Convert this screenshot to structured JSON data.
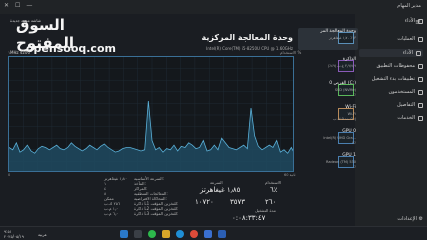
{
  "window": {
    "title": "مدير المهام",
    "controls": [
      "—",
      "☐",
      "✕"
    ]
  },
  "watermark": {
    "arabic": "السوق المفتوح",
    "latin": "opensooq.com",
    "small_top": "شاشة مهمة جديدة",
    "small_bottom": "MHz 4200"
  },
  "nav": {
    "menu_icon": "hamburger-icon",
    "items": [
      {
        "label": "الأداء",
        "icon": "search-icon"
      },
      {
        "label": "العمليات",
        "icon": "grid-icon"
      },
      {
        "label": "الأداء",
        "icon": "chart-icon",
        "active": true
      },
      {
        "label": "محفوظات التطبيق",
        "icon": "history-icon"
      },
      {
        "label": "تطبيقات بدء التشغيل",
        "icon": "rocket-icon"
      },
      {
        "label": "المستخدمون",
        "icon": "users-icon"
      },
      {
        "label": "التفاصيل",
        "icon": "list-icon"
      },
      {
        "label": "الخدمات",
        "icon": "puzzle-icon"
      }
    ],
    "settings_label": "الإعدادات"
  },
  "devices": [
    {
      "label": "وحدة المعالجة المر",
      "sub": "١٣٪ ١٫٧٠ غيغاهرتز",
      "selected": true
    },
    {
      "label": "الذاكرة",
      "sub": "٣٫٩/٧٫٩ غ.ب (٤٩٪)"
    },
    {
      "label": "القرص 0 (C:)",
      "sub": "SSD (NVMe)",
      "sub2": "٠٪"
    },
    {
      "label": "Wi-Fi",
      "sub": "Wi-Fi",
      "sub2": "إ: 0 ت: 0 ك.ب"
    },
    {
      "label": "GPU 0",
      "sub": "Intel(R) UHD Gra...",
      "sub2": "٢٪"
    },
    {
      "label": "GPU 1",
      "sub": "Radeon (TM) 530",
      "sub2": "٠٪"
    }
  ],
  "main": {
    "title": "وحدة المعالجة المركزية",
    "subtitle": "Intel(R) Core(TM) i5-8250U CPU @ 1.60GHz",
    "chart_top_left": "١٠٠٪",
    "chart_top_right": "الاستخدام %",
    "chart_bottom_left": "0",
    "chart_bottom_right": "60 ثانية"
  },
  "stats": {
    "utilization_label": "الاستخدام",
    "utilization_value": "٦٪",
    "speed_label": "السرعة",
    "speed_value": "١٫٨٥ غيغاهرتز",
    "processes_value": "٢٦٠",
    "threads_value": "٣٥٧٣",
    "handles_value": "١٠٧٢٠",
    "uptime_label": "مدة التشغيل",
    "uptime_value": "٠:٠٨:٣٣:٤٧",
    "right_col": [
      "السرعة الأساسية:",
      "المآخذ:",
      "المراكز:",
      "المعالجات المنطقية:",
      "المحاكاة الافتراضية:",
      "ذاكرة L1 للتخزين المؤقت:",
      "ذاكرة L2 للتخزين المؤقت:",
      "ذاكرة L3 للتخزين المؤقت:"
    ],
    "right_vals": [
      "١٫٨٠ غيغاهرتز",
      "١",
      "٤",
      "٨",
      "ممكن",
      "٢٥٦ ك.ب",
      "١٫٠ م.ب",
      "٦٫٠ م.ب"
    ]
  },
  "chart_data": {
    "type": "area",
    "title": "",
    "ylim": [
      0,
      100
    ],
    "xlabel": "",
    "ylabel": "",
    "series": [
      {
        "values": [
          22,
          20,
          26,
          18,
          20,
          24,
          19,
          17,
          21,
          23,
          22,
          20,
          22,
          24,
          21,
          20,
          22,
          26,
          23,
          21,
          19,
          21,
          24,
          22,
          20,
          23,
          25,
          22,
          20,
          18,
          19,
          21,
          22,
          22,
          21,
          20,
          19,
          20,
          62,
          28,
          20,
          22,
          18,
          21,
          20,
          24,
          19,
          23,
          22,
          26,
          24,
          21,
          22,
          28,
          19,
          20,
          24,
          20,
          30,
          26,
          22,
          21,
          20,
          22,
          24,
          21,
          56,
          32,
          23,
          20,
          22,
          24,
          22,
          28,
          18,
          20,
          17,
          22,
          16
        ]
      }
    ]
  },
  "taskbar": {
    "lang": "عربية",
    "time": "٩:٥١",
    "date": "٢٠٢٥/٠٥/١٩",
    "icons": [
      "windows-icon",
      "search-icon",
      "chrome-icon",
      "edge-icon",
      "folder-icon",
      "whatsapp-icon",
      "store-icon",
      "word-icon"
    ]
  },
  "colors": {
    "accent": "#3a6f96",
    "fill": "#1f4a60",
    "line": "#5ab0d8"
  }
}
